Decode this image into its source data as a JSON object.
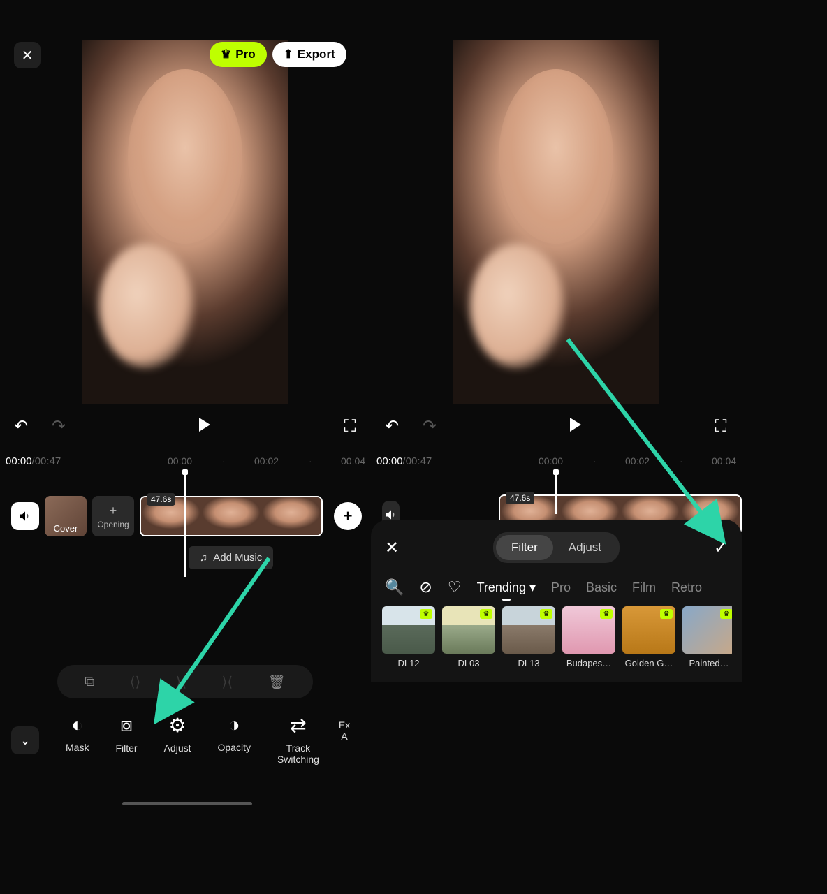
{
  "buttons": {
    "pro": "Pro",
    "export": "Export"
  },
  "time": {
    "current": "00:00",
    "duration": "00:47",
    "marks": [
      "00:00",
      "00:02",
      "00:04"
    ]
  },
  "timeline": {
    "cover": "Cover",
    "opening": "Opening",
    "clip_duration": "47.6s",
    "add_music": "Add Music"
  },
  "tools": {
    "mask": "Mask",
    "filter": "Filter",
    "adjust": "Adjust",
    "opacity": "Opacity",
    "track_switching": "Track\nSwitching",
    "extra": "Ex\nA"
  },
  "filter_panel": {
    "tab_filter": "Filter",
    "tab_adjust": "Adjust",
    "cats": [
      "Trending",
      "Pro",
      "Basic",
      "Film",
      "Retro"
    ],
    "thumbs": [
      {
        "name": "DL12",
        "pro": true
      },
      {
        "name": "DL03",
        "pro": true
      },
      {
        "name": "DL13",
        "pro": true
      },
      {
        "name": "Budapes…",
        "pro": true
      },
      {
        "name": "Golden G…",
        "pro": true
      },
      {
        "name": "Painted…",
        "pro": true
      }
    ]
  }
}
